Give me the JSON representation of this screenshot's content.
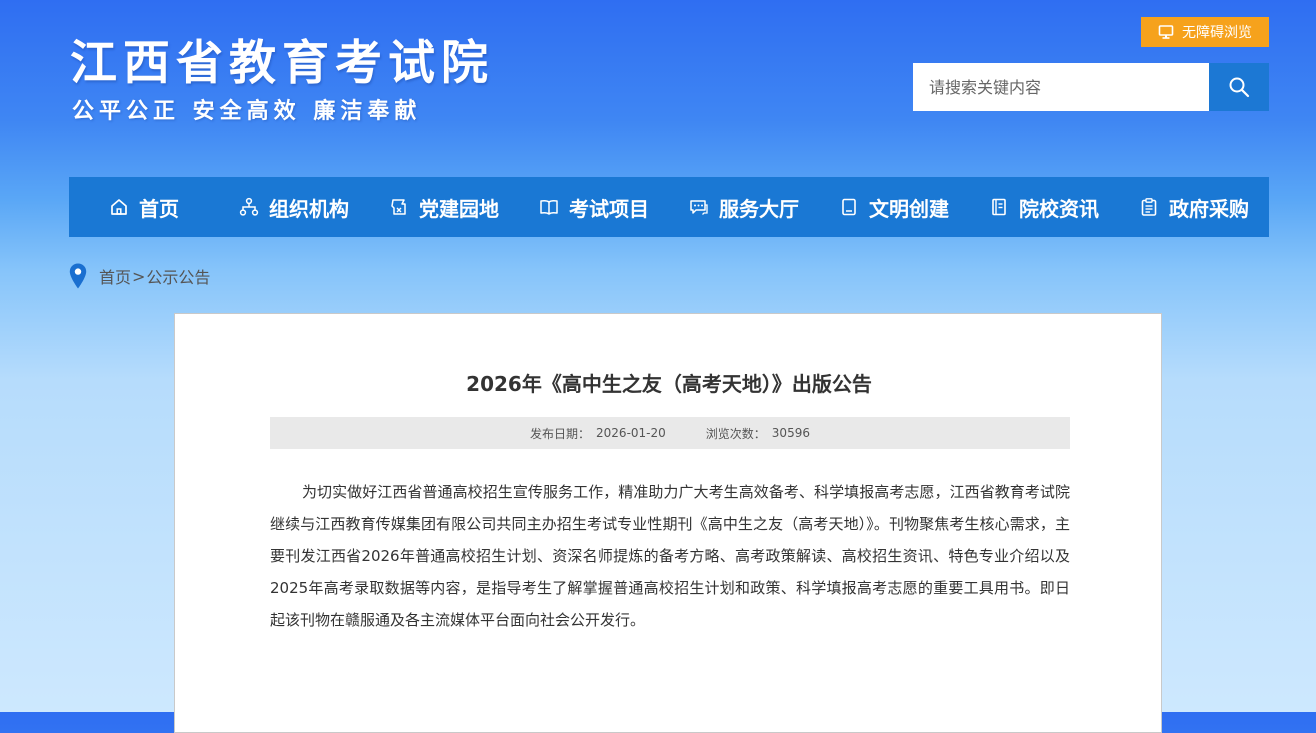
{
  "header": {
    "site_title": "江西省教育考试院",
    "slogan": "公平公正  安全高效  廉洁奉献",
    "accessibility_label": "无障碍浏览",
    "search_placeholder": "请搜索关键内容"
  },
  "nav": {
    "items": [
      {
        "label": "首页",
        "icon": "home-icon"
      },
      {
        "label": "组织机构",
        "icon": "org-chart-icon"
      },
      {
        "label": "党建园地",
        "icon": "party-building-icon"
      },
      {
        "label": "考试项目",
        "icon": "book-icon"
      },
      {
        "label": "服务大厅",
        "icon": "service-chat-icon"
      },
      {
        "label": "文明创建",
        "icon": "notebook-icon"
      },
      {
        "label": "院校资讯",
        "icon": "document-icon"
      },
      {
        "label": "政府采购",
        "icon": "clipboard-icon"
      }
    ]
  },
  "breadcrumb": {
    "home": "首页",
    "separator": ">",
    "current": "公示公告"
  },
  "article": {
    "title": "2026年《高中生之友（高考天地）》出版公告",
    "publish_label": "发布日期：",
    "publish_date": "2026-01-20",
    "views_label": "浏览次数：",
    "views": "30596",
    "body": "为切实做好江西省普通高校招生宣传服务工作，精准助力广大考生高效备考、科学填报高考志愿，江西省教育考试院继续与江西教育传媒集团有限公司共同主办招生考试专业性期刊《高中生之友（高考天地）》。刊物聚焦考生核心需求，主要刊发江西省2026年普通高校招生计划、资深名师提炼的备考方略、高考政策解读、高校招生资讯、特色专业介绍以及2025年高考录取数据等内容，是指导考生了解掌握普通高校招生计划和政策、科学填报高考志愿的重要工具用书。即日起该刊物在赣服通及各主流媒体平台面向社会公开发行。"
  },
  "colors": {
    "nav_bg": "#1a78d4",
    "accessibility_bg": "#f6a21c",
    "search_button_bg": "#1c78d4",
    "breadcrumb_pin": "#1a6fd0"
  }
}
